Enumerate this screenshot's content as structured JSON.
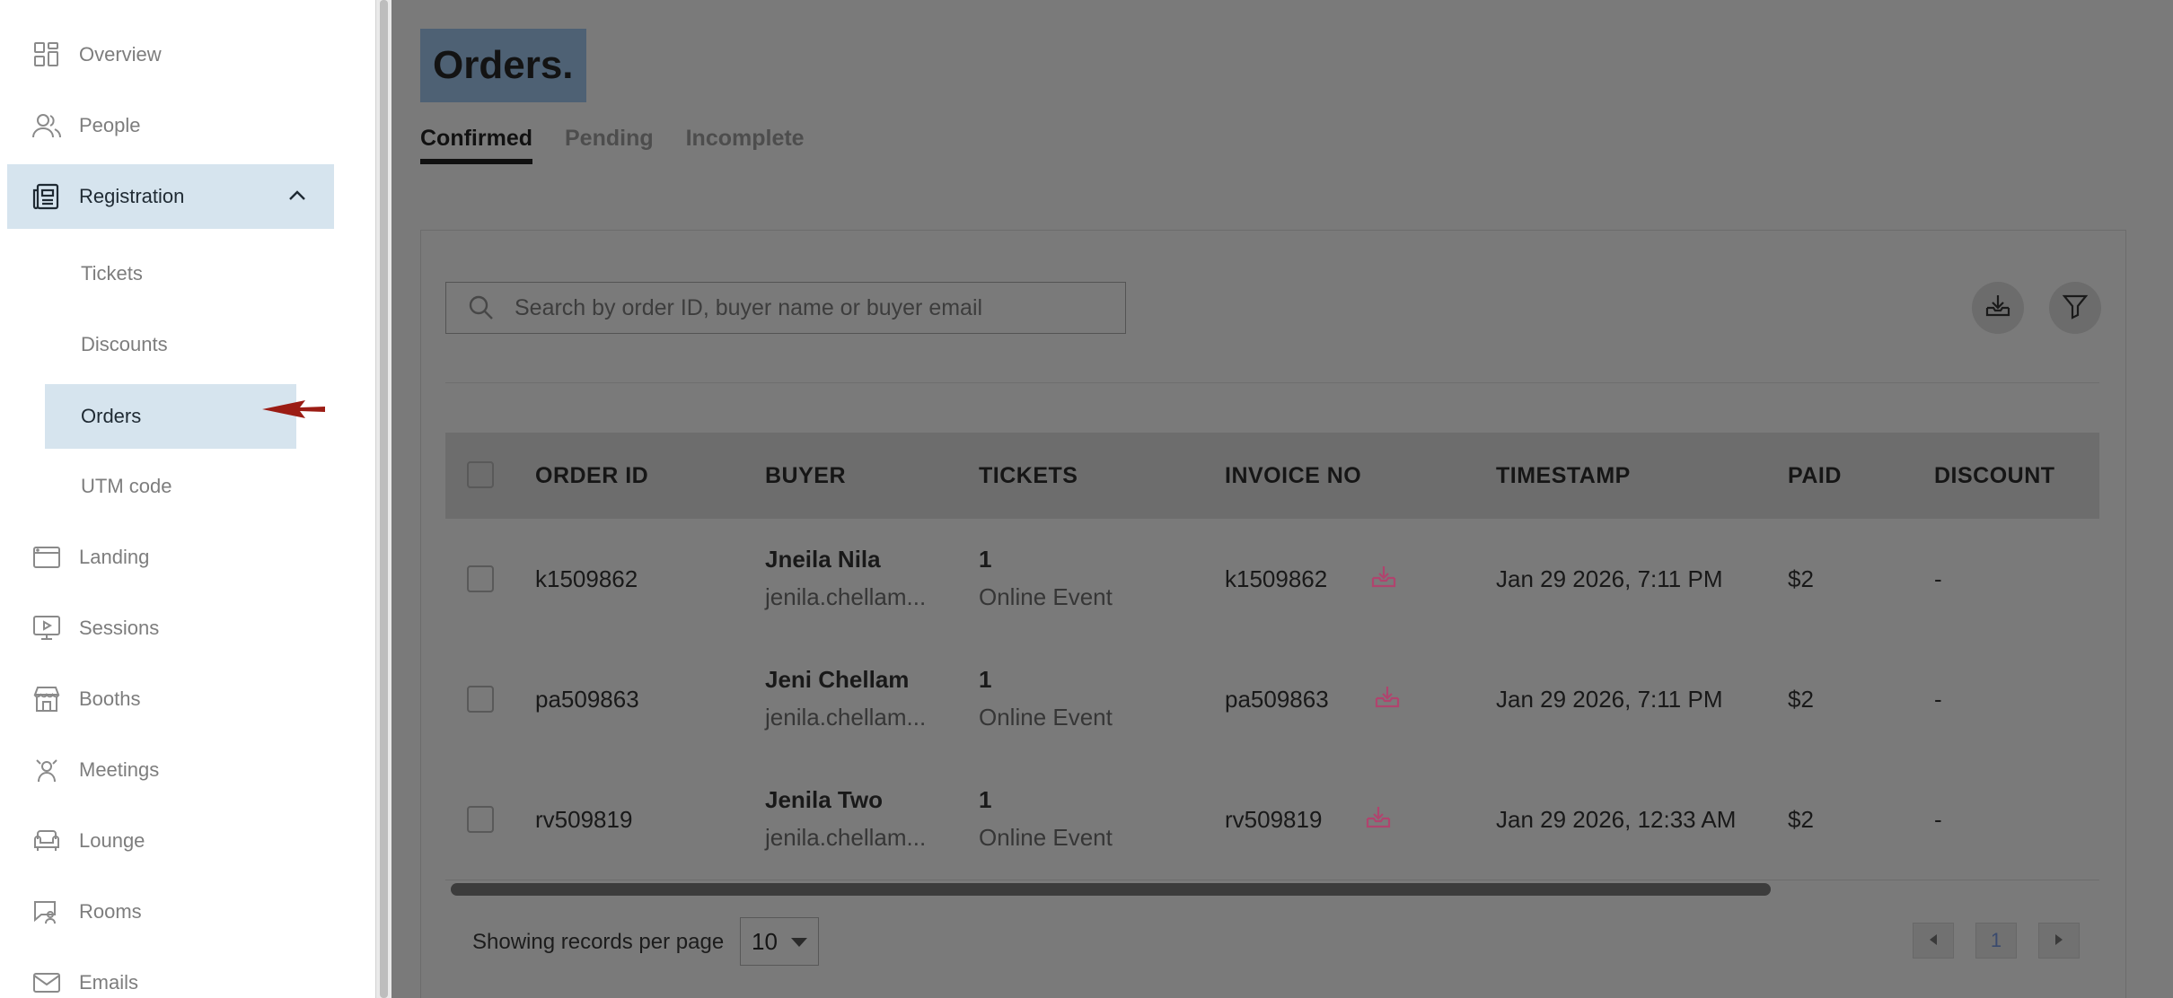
{
  "sidebar": {
    "items": [
      {
        "label": "Overview",
        "icon": "overview-grid-icon"
      },
      {
        "label": "People",
        "icon": "people-icon"
      },
      {
        "label": "Registration",
        "icon": "registration-icon",
        "expanded": true
      },
      {
        "label": "Landing",
        "icon": "landing-icon"
      },
      {
        "label": "Sessions",
        "icon": "sessions-icon"
      },
      {
        "label": "Booths",
        "icon": "booths-icon"
      },
      {
        "label": "Meetings",
        "icon": "meetings-icon"
      },
      {
        "label": "Lounge",
        "icon": "lounge-icon"
      },
      {
        "label": "Rooms",
        "icon": "rooms-icon"
      },
      {
        "label": "Emails",
        "icon": "emails-icon"
      }
    ],
    "registration_sub": [
      "Tickets",
      "Discounts",
      "Orders",
      "UTM code"
    ],
    "active_sub": "Orders"
  },
  "main": {
    "title": "Orders.",
    "tabs": [
      {
        "label": "Confirmed",
        "active": true
      },
      {
        "label": "Pending",
        "active": false
      },
      {
        "label": "Incomplete",
        "active": false
      }
    ],
    "search": {
      "placeholder": "Search by order ID, buyer name or buyer email"
    },
    "table": {
      "columns": [
        "ORDER ID",
        "BUYER",
        "TICKETS",
        "INVOICE NO",
        "TIMESTAMP",
        "PAID",
        "DISCOUNT"
      ],
      "rows": [
        {
          "order_id": "k1509862",
          "buyer_name": "Jneila Nila",
          "buyer_email": "jenila.chellam...",
          "tickets_count": "1",
          "ticket_type": "Online Event",
          "invoice_no": "k1509862",
          "timestamp": "Jan 29 2026, 7:11 PM",
          "paid": "$2",
          "discount": "-"
        },
        {
          "order_id": "pa509863",
          "buyer_name": "Jeni Chellam",
          "buyer_email": "jenila.chellam...",
          "tickets_count": "1",
          "ticket_type": "Online Event",
          "invoice_no": "pa509863",
          "timestamp": "Jan 29 2026, 7:11 PM",
          "paid": "$2",
          "discount": "-"
        },
        {
          "order_id": "rv509819",
          "buyer_name": "Jenila Two",
          "buyer_email": "jenila.chellam...",
          "tickets_count": "1",
          "ticket_type": "Online Event",
          "invoice_no": "rv509819",
          "timestamp": "Jan 29 2026, 12:33 AM",
          "paid": "$2",
          "discount": "-"
        }
      ]
    },
    "pagination": {
      "per_page_label": "Showing records per page",
      "per_page_value": "10",
      "current_page": "1"
    }
  },
  "colors": {
    "active_bg": "#d6e4ee",
    "overlay": "#7a7a7a",
    "title_highlight": "#4e6174",
    "invoice_icon": "#b0446e",
    "annotation_arrow": "#9b1c14"
  }
}
